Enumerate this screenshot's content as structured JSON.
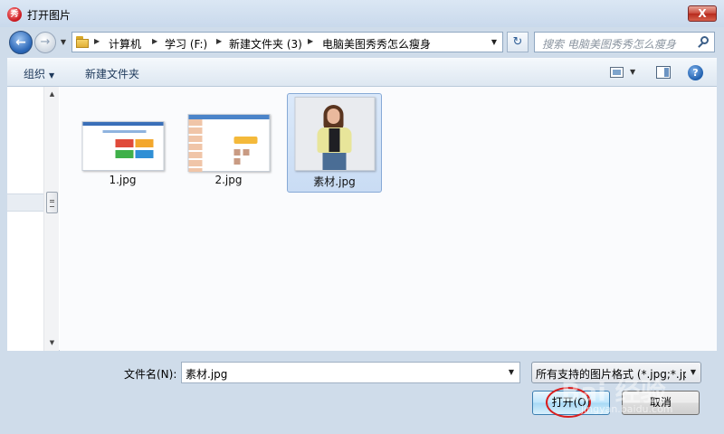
{
  "window": {
    "title": "打开图片",
    "app_icon_glyph": "秀",
    "close_glyph": "X"
  },
  "nav": {
    "back_glyph": "←",
    "forward_glyph": "→",
    "history_glyph": "▼",
    "breadcrumb": [
      "计算机",
      "学习 (F:)",
      "新建文件夹 (3)",
      "电脑美图秀秀怎么瘦身"
    ],
    "breadcrumb_sep": "▶",
    "address_drop_glyph": "▼",
    "refresh_glyph": "↻",
    "search_placeholder": "搜索 电脑美图秀秀怎么瘦身"
  },
  "toolbar": {
    "organize_label": "组织",
    "organize_caret": "▼",
    "new_folder_label": "新建文件夹",
    "view_caret": "▼",
    "help_glyph": "?"
  },
  "scrollbar": {
    "up_glyph": "▲",
    "down_glyph": "▼"
  },
  "files": [
    {
      "name": "1.jpg",
      "selected": false
    },
    {
      "name": "2.jpg",
      "selected": false
    },
    {
      "name": "素材.jpg",
      "selected": true
    }
  ],
  "footer": {
    "filename_label": "文件名(N):",
    "filename_value": "素材.jpg",
    "filename_drop_glyph": "▼",
    "filetype_value": "所有支持的图片格式 (*.jpg;*.jp",
    "filetype_drop_glyph": "▼",
    "open_label": "打开(O)",
    "cancel_label": "取消"
  },
  "colors": {
    "annotation_circle": "#d91e1e",
    "selection_bg": "#c9dcf4",
    "close_button": "#c9483a"
  },
  "watermark": {
    "main": "Bai 经验",
    "sub": "jingyan.baidu.com"
  }
}
